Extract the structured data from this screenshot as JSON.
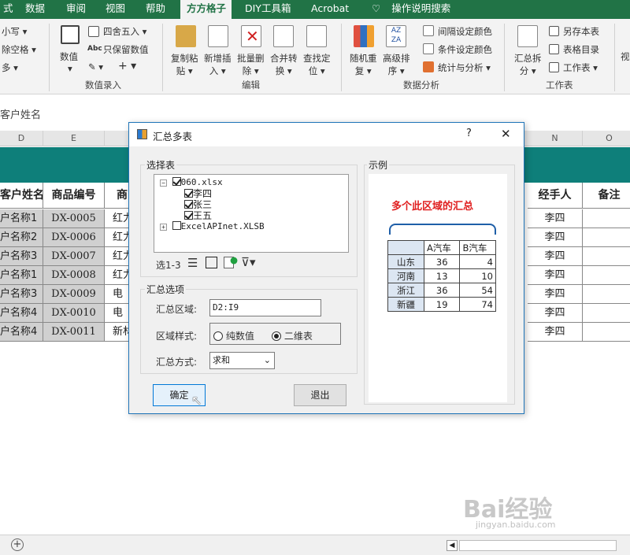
{
  "ribbon": {
    "tabs": [
      "式",
      "数据",
      "审阅",
      "视图",
      "帮助",
      "方方格子",
      "DIY工具箱",
      "Acrobat",
      "操作说明搜索"
    ],
    "left_items": [
      "小写",
      "除空格",
      "多"
    ],
    "buttons": {
      "numeric": "数值",
      "round": "四舍五入",
      "keep_numeric": "只保留数值",
      "abc": "Abc",
      "copy_paste": [
        "复制粘",
        "贴"
      ],
      "new_insert": [
        "新增插",
        "入"
      ],
      "batch_delete": [
        "批量删",
        "除"
      ],
      "merge_convert": [
        "合并转",
        "换"
      ],
      "find_locate": [
        "查找定",
        "位"
      ],
      "random_repeat": [
        "随机重",
        "复"
      ],
      "advanced_sort": [
        "高级排",
        "序"
      ],
      "interval_color": "间隔设定颜色",
      "condition_color": "条件设定颜色",
      "stats_analysis": "统计与分析",
      "summary_split": [
        "汇总拆",
        "分"
      ],
      "save_book": "另存本表",
      "table_catalog": "表格目录",
      "worksheet": "工作表",
      "view_cut": "视"
    },
    "groups": [
      "数值录入",
      "编辑",
      "数据分析",
      "工作表"
    ]
  },
  "formula": {
    "name_box": "客户姓名"
  },
  "columns": [
    "D",
    "E",
    "N",
    "O"
  ],
  "sheet": {
    "headers": {
      "customer": "客户姓名",
      "code": "商品编号",
      "product": "商",
      "handler": "经手人",
      "remark": "备注"
    },
    "rows": [
      {
        "customer": "户名称1",
        "code": "DX-0005",
        "product": "红力",
        "handler": "李四"
      },
      {
        "customer": "户名称2",
        "code": "DX-0006",
        "product": "红力",
        "handler": "李四"
      },
      {
        "customer": "户名称3",
        "code": "DX-0007",
        "product": "红力",
        "handler": "李四"
      },
      {
        "customer": "户名称1",
        "code": "DX-0008",
        "product": "红力",
        "handler": "李四"
      },
      {
        "customer": "户名称3",
        "code": "DX-0009",
        "product": "电",
        "handler": "李四"
      },
      {
        "customer": "户名称4",
        "code": "DX-0010",
        "product": "电",
        "handler": "李四"
      },
      {
        "customer": "户名称4",
        "code": "DX-0011",
        "product": "新材",
        "handler": "李四"
      }
    ]
  },
  "dialog": {
    "title": "汇总多表",
    "help": "?",
    "close": "✕",
    "select_table_legend": "选择表",
    "tree": [
      {
        "label": "060.xlsx",
        "checked": true,
        "expanded": true,
        "children": [
          "李四",
          "张三",
          "王五"
        ]
      },
      {
        "label": "ExcelAPInet.XLSB",
        "checked": false,
        "expanded": false
      }
    ],
    "selection_count": "选1-3",
    "options_legend": "汇总选项",
    "range_label": "汇总区域:",
    "range_value": "D2:I9",
    "style_label": "区域样式:",
    "style_options": [
      "纯数值",
      "二维表"
    ],
    "style_selected": "二维表",
    "method_label": "汇总方式:",
    "method_value": "求和",
    "ok": "确定",
    "exit": "退出",
    "example_legend": "示例",
    "example_caption": "多个此区域的汇总",
    "example_table": {
      "headers": [
        "",
        "A汽车",
        "B汽车"
      ],
      "rows": [
        [
          "山东",
          "36",
          "4"
        ],
        [
          "河南",
          "13",
          "10"
        ],
        [
          "浙江",
          "36",
          "54"
        ],
        [
          "新疆",
          "19",
          "74"
        ]
      ]
    }
  },
  "colors": {
    "excel_green": "#217346",
    "teal_band": "#0e7f7a",
    "example_red": "#e02020"
  },
  "watermark": {
    "brand": "Bai经验",
    "url": "jingyan.baidu.com"
  }
}
